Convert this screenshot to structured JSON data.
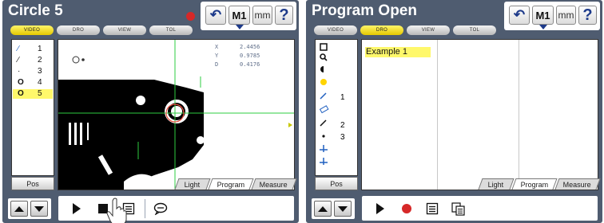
{
  "left": {
    "title": "Circle 5",
    "header": {
      "m1": "M1",
      "mm": "mm",
      "help": "?"
    },
    "tabs": [
      "VIDEO",
      "DRO",
      "VIEW",
      "TOL"
    ],
    "features": [
      {
        "num": "1"
      },
      {
        "num": "2"
      },
      {
        "num": "3"
      },
      {
        "num": "4"
      },
      {
        "num": "5"
      }
    ],
    "pos_label": "Pos",
    "readout": {
      "x_label": "X",
      "x_value": "2.4456",
      "y_label": "Y",
      "y_value": "0.9785",
      "d_label": "D",
      "d_value": "0.4176"
    },
    "bottom_tabs": [
      "Light",
      "Program",
      "Measure"
    ]
  },
  "right": {
    "title": "Program Open",
    "header": {
      "m1": "M1",
      "mm": "mm",
      "help": "?"
    },
    "tabs": [
      "VIDEO",
      "DRO",
      "VIEW",
      "TOL"
    ],
    "tool_numbers": [
      "1",
      "2",
      "3"
    ],
    "pos_label": "Pos",
    "program_item": "Example 1",
    "bottom_tabs": [
      "Light",
      "Program",
      "Measure"
    ]
  },
  "colors": {
    "panel": "#4f5c70",
    "highlight": "#fff86b",
    "record": "#d62828",
    "crosshair": "#2ecc40",
    "target": "#e74c3c"
  }
}
